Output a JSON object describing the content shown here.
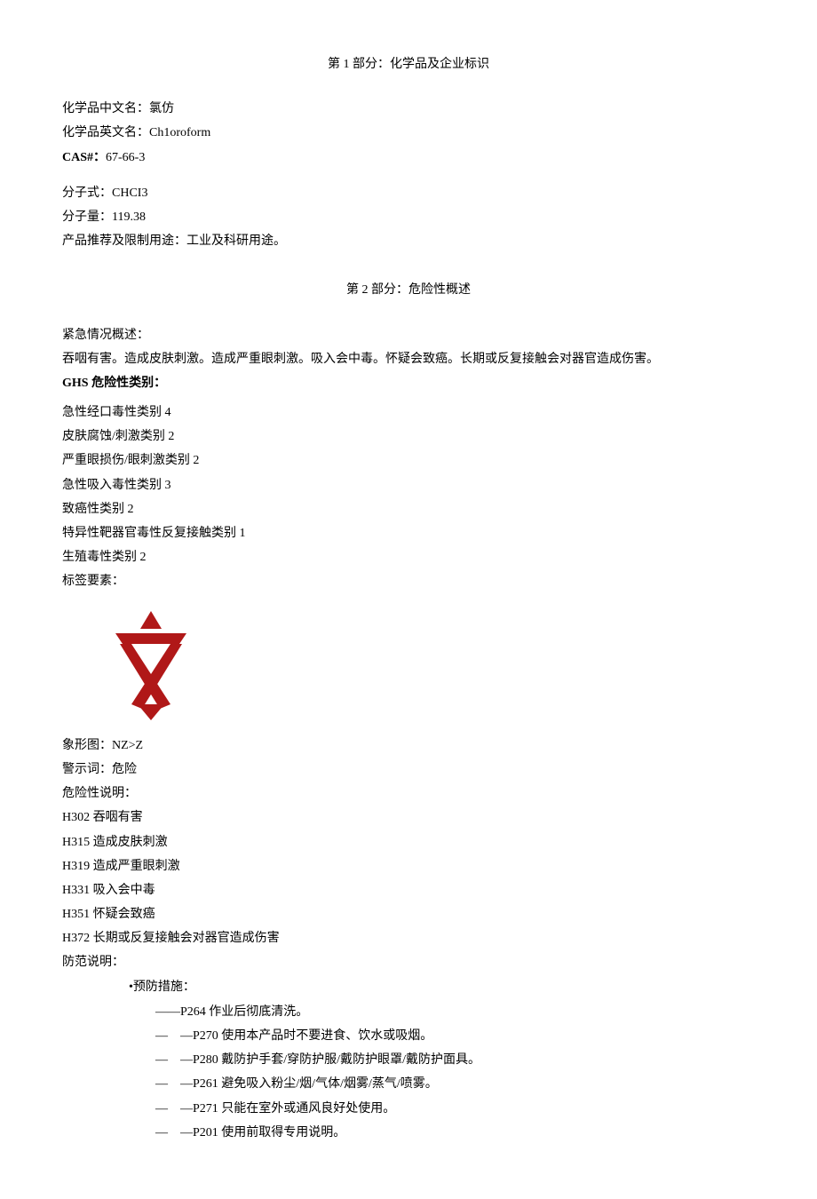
{
  "section1": {
    "title": "第 1 部分：化学品及企业标识",
    "chinese_name_label": "化学品中文名：",
    "chinese_name": "氯仿",
    "english_name_label": "化学品英文名：",
    "english_name": "Ch1oroform",
    "cas_label": "CAS#：",
    "cas": "67-66-3",
    "formula_label": "分子式：",
    "formula": "CHCI3",
    "mw_label": "分子量：",
    "mw": "119.38",
    "use_label": "产品推荐及限制用途：",
    "use": "工业及科研用途。"
  },
  "section2": {
    "title": "第 2 部分：危险性概述",
    "emergency_label": "紧急情况概述：",
    "emergency_text": "吞咽有害。造成皮肤刺激。造成严重眼刺激。吸入会中毒。怀疑会致癌。长期或反复接触会对器官造成伤害。",
    "ghs_label": "GHS 危险性类别：",
    "ghs_categories": [
      "急性经口毒性类别 4",
      "皮肤腐蚀/刺激类别 2",
      "严重眼损伤/眼刺激类别 2",
      "急性吸入毒性类别 3",
      "致癌性类别 2",
      "特异性靶器官毒性反复接触类别 1",
      "生殖毒性类别 2"
    ],
    "label_elements": "标签要素：",
    "pictogram_label": "象形图：",
    "pictogram_value": "NZ>Z",
    "signal_word_label": "警示词：",
    "signal_word": "危险",
    "hazard_stmt_label": "危险性说明：",
    "hazard_statements": [
      "H302 吞咽有害",
      "H315 造成皮肤刺激",
      "H319 造成严重眼刺激",
      "H331 吸入会中毒",
      "H351 怀疑会致癌",
      "H372 长期或反复接触会对器官造成伤害"
    ],
    "precaution_label": "防范说明：",
    "prevention_label": "•预防措施：",
    "prevention_first": "——P264 作业后彻底清洗。",
    "prevention_items": [
      "—P270 使用本产品时不要进食、饮水或吸烟。",
      "—P280 戴防护手套/穿防护服/戴防护眼罩/戴防护面具。",
      "—P261 避免吸入粉尘/烟/气体/烟雾/蒸气/喷雾。",
      "—P271 只能在室外或通风良好处使用。",
      "—P201 使用前取得专用说明。"
    ]
  }
}
